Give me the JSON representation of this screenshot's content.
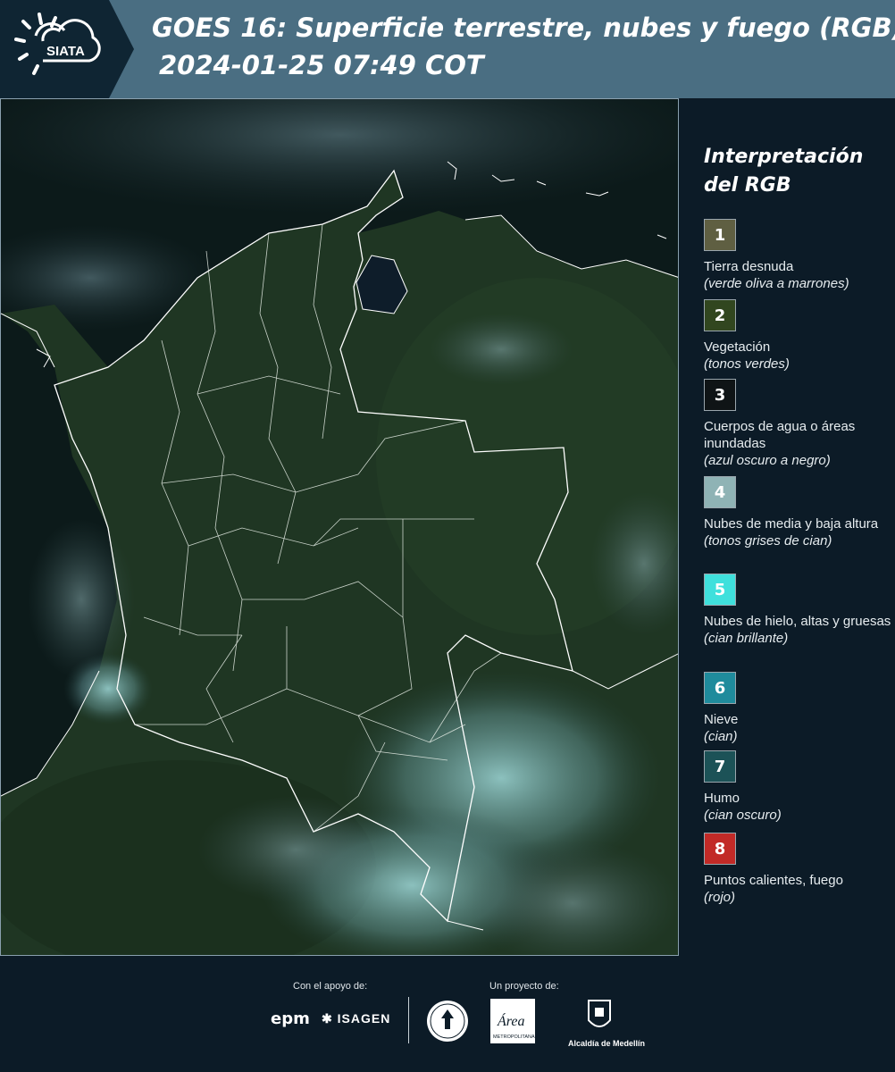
{
  "header": {
    "title": "GOES 16: Superficie terrestre, nubes y fuego (RGB)",
    "datetime": "2024-01-25 07:49 COT",
    "logo_text": "SIATA"
  },
  "map": {
    "description_icon": "satellite-rgb-map",
    "colors": {
      "land": "#1f3826",
      "ocean": "#0b1a1a",
      "border": "#ffffff"
    }
  },
  "legend": {
    "title": "Interpretación del RGB",
    "items": [
      {
        "number": "1",
        "label": "Tierra desnuda",
        "sub": "(verde oliva a marrones)",
        "color": "#5f5f42"
      },
      {
        "number": "2",
        "label": "Vegetación",
        "sub": "(tonos verdes)",
        "color": "#31461f"
      },
      {
        "number": "3",
        "label": "Cuerpos de agua o áreas inundadas",
        "sub": "(azul oscuro a negro)",
        "color": "#0f1416"
      },
      {
        "number": "4",
        "label": "Nubes de media y baja altura",
        "sub": "(tonos grises de cian)",
        "color": "#8fb3b5"
      },
      {
        "number": "5",
        "label": "Nubes de hielo, altas y gruesas",
        "sub": "(cian brillante)",
        "color": "#3fe0dc"
      },
      {
        "number": "6",
        "label": "Nieve",
        "sub": "(cian)",
        "color": "#1f8b9c"
      },
      {
        "number": "7",
        "label": "Humo",
        "sub": "(cian oscuro)",
        "color": "#1c5257"
      },
      {
        "number": "8",
        "label": "Puntos calientes, fuego",
        "sub": "(rojo)",
        "color": "#c22a27"
      }
    ]
  },
  "footer": {
    "support_label": "Con el apoyo de:",
    "project_label": "Un proyecto de:",
    "epm": "epm",
    "isagen": "ISAGEN",
    "area_metro": "Área",
    "area_metro_sub": "METROPOLITANA",
    "medellin": "Alcaldía de Medellín"
  }
}
